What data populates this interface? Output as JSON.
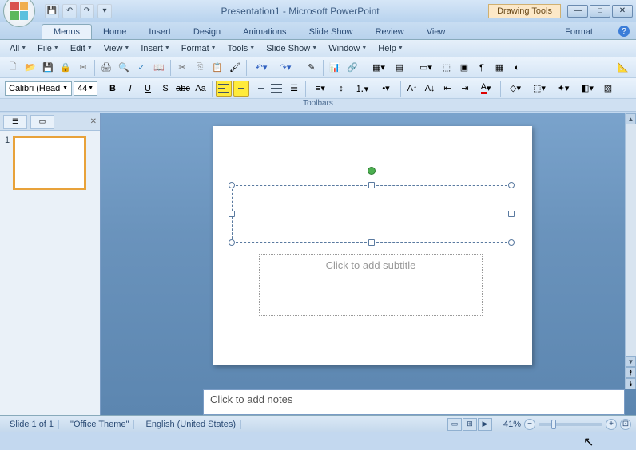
{
  "titlebar": {
    "doc_title": "Presentation1 - Microsoft PowerPoint",
    "context_tools": "Drawing Tools"
  },
  "ribbon_tabs": [
    "Menus",
    "Home",
    "Insert",
    "Design",
    "Animations",
    "Slide Show",
    "Review",
    "View"
  ],
  "ribbon_active": 0,
  "context_tab": "Format",
  "classic_menus": [
    "All",
    "File",
    "Edit",
    "View",
    "Insert",
    "Format",
    "Tools",
    "Slide Show",
    "Window",
    "Help"
  ],
  "font": {
    "name": "Calibri (Head",
    "size": "44"
  },
  "toolbars_label": "Toolbars",
  "outline": {
    "slides": [
      {
        "num": "1"
      }
    ]
  },
  "slide": {
    "subtitle_placeholder": "Click to add subtitle"
  },
  "notes_placeholder": "Click to add notes",
  "status": {
    "slide_info": "Slide 1 of 1",
    "theme": "\"Office Theme\"",
    "language": "English (United States)",
    "zoom": "41%"
  }
}
